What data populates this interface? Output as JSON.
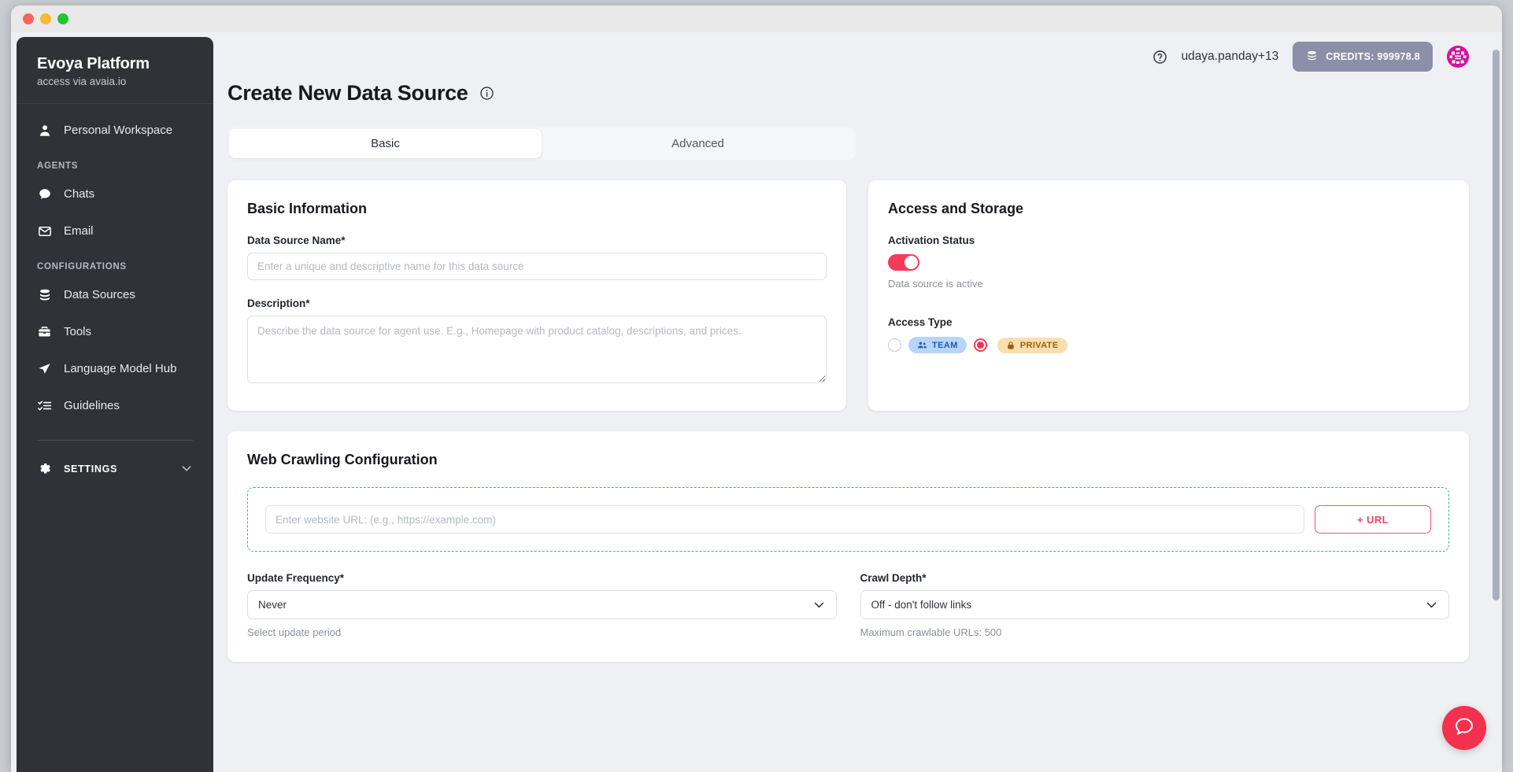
{
  "window": {
    "traffic_lights": [
      "close",
      "minimize",
      "maximize"
    ]
  },
  "sidebar": {
    "brand_title": "Evoya Platform",
    "brand_subtitle": "access via avaia.io",
    "workspace": {
      "label": "Personal Workspace",
      "icon": "person-icon"
    },
    "sections": [
      {
        "heading": "AGENTS",
        "items": [
          {
            "label": "Chats",
            "icon": "chat-bubble-icon"
          },
          {
            "label": "Email",
            "icon": "envelope-icon"
          }
        ]
      },
      {
        "heading": "CONFIGURATIONS",
        "items": [
          {
            "label": "Data Sources",
            "icon": "database-icon"
          },
          {
            "label": "Tools",
            "icon": "toolbox-icon"
          },
          {
            "label": "Language Model Hub",
            "icon": "send-icon"
          },
          {
            "label": "Guidelines",
            "icon": "checklist-icon"
          }
        ]
      }
    ],
    "settings": {
      "label": "SETTINGS",
      "icon": "gear-icon",
      "chevron": "chevron-down-icon"
    }
  },
  "topbar": {
    "help_icon": "question-circle-icon",
    "user_name": "udaya.panday+13",
    "credits_label": "CREDITS: 999978.8",
    "credits_icon": "coins-icon",
    "avatar": "user-avatar-identicon"
  },
  "page": {
    "title": "Create New Data Source",
    "title_info_icon": "info-circle-icon"
  },
  "tabs": [
    {
      "label": "Basic",
      "active": true
    },
    {
      "label": "Advanced",
      "active": false
    }
  ],
  "basic_information": {
    "card_title": "Basic Information",
    "name_label": "Data Source Name*",
    "name_value": "",
    "name_placeholder": "Enter a unique and descriptive name for this data source",
    "description_label": "Description*",
    "description_value": "",
    "description_placeholder": "Describe the data source for agent use. E.g., Homepage with product catalog, descriptions, and prices."
  },
  "access_and_storage": {
    "card_title": "Access and Storage",
    "activation_label": "Activation Status",
    "activation_on": true,
    "activation_hint": "Data source is active",
    "access_type_label": "Access Type",
    "options": [
      {
        "label": "TEAM",
        "icon": "people-icon",
        "selected": false
      },
      {
        "label": "PRIVATE",
        "icon": "lock-icon",
        "selected": true
      }
    ]
  },
  "web_crawling": {
    "card_title": "Web Crawling Configuration",
    "url_value": "",
    "url_placeholder": "Enter website URL: (e.g., https://example.com)",
    "add_url_label": "+ URL",
    "update_frequency_label": "Update Frequency*",
    "update_frequency_value": "Never",
    "update_frequency_hint": "Select update period",
    "crawl_depth_label": "Crawl Depth*",
    "crawl_depth_value": "Off - don't follow links",
    "crawl_depth_hint": "Maximum crawlable URLs: 500",
    "chevron_icon": "chevron-down-icon"
  },
  "chat_fab": {
    "icon": "chat-bubble-icon"
  },
  "colors": {
    "accent_red": "#f4304f",
    "sidebar_bg": "#2f3237",
    "page_bg": "#eef0f4",
    "credits_bg": "#8b8fa8",
    "team_chip_bg": "#b8d4f7",
    "team_chip_fg": "#1b5fae",
    "private_chip_bg": "#fadfae",
    "private_chip_fg": "#9a6208",
    "dropzone_border": "#3ca0e7",
    "avatar_bg": "#d9109f"
  }
}
